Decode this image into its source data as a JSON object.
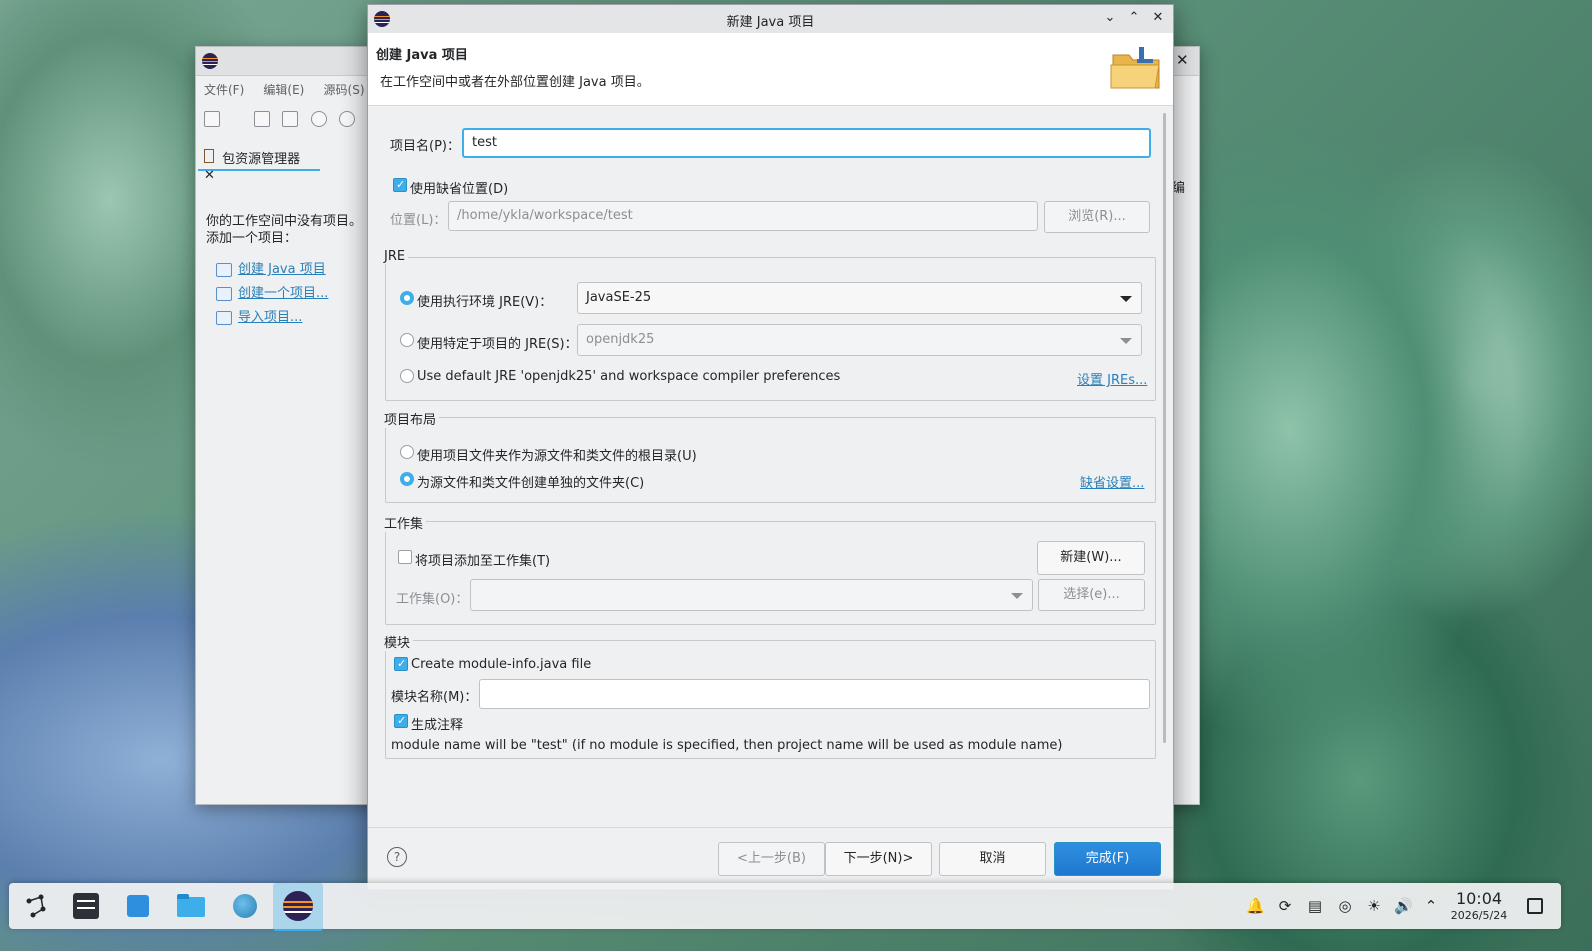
{
  "background_window": {
    "menu": [
      "文件(F)",
      "编辑(E)",
      "源码(S)"
    ],
    "package_tab_label": "包资源管理器",
    "empty_text_line1": "你的工作空间中没有项目。",
    "empty_text_line2": "添加一个项目：",
    "links": [
      "创建 Java 项目",
      "创建一个项目...",
      "导入项目..."
    ],
    "right_edge_text": "编"
  },
  "dialog": {
    "title": "新建 Java 项目",
    "header_title": "创建 Java 项目",
    "header_desc": "在工作空间中或者在外部位置创建 Java 项目。",
    "project_name_label": "项目名(P)：",
    "project_name_value": "test",
    "use_default_location_label": "使用缺省位置(D)",
    "use_default_location_checked": true,
    "location_label": "位置(L)：",
    "location_value": "/home/ykla/workspace/test",
    "browse_button": "浏览(R)...",
    "jre_group": "JRE",
    "jre_opt1_label": "使用执行环境 JRE(V)：",
    "jre_opt1_value": "JavaSE-25",
    "jre_opt2_label": "使用特定于项目的 JRE(S)：",
    "jre_opt2_value": "openjdk25",
    "jre_opt3_label": "Use default JRE 'openjdk25' and workspace compiler preferences",
    "jre_link": "设置 JREs...",
    "jre_selected": 1,
    "layout_group": "项目布局",
    "layout_opt1": "使用项目文件夹作为源文件和类文件的根目录(U)",
    "layout_opt2": "为源文件和类文件创建单独的文件夹(C)",
    "layout_link": "缺省设置...",
    "layout_selected": 2,
    "workingset_group": "工作集",
    "workingset_add_label": "将项目添加至工作集(T)",
    "workingset_new_button": "新建(W)...",
    "workingset_label": "工作集(O)：",
    "workingset_value": "",
    "workingset_select_button": "选择(e)...",
    "module_group": "模块",
    "module_create_label": "Create module-info.java file",
    "module_name_label": "模块名称(M)：",
    "module_name_value": "",
    "module_comments_label": "生成注释",
    "module_info_text": "module name will be \"test\" (if no module is specified, then project name will be used as module name)",
    "help_glyph": "?",
    "back_button": "<上一步(B)",
    "next_button": "下一步(N)>",
    "cancel_button": "取消",
    "finish_button": "完成(F)"
  },
  "taskbar": {
    "time": "10:04",
    "date": "2026/5/24",
    "apps": [
      "application-launcher-icon",
      "system-settings-icon",
      "discover-store-icon",
      "file-manager-icon",
      "web-browser-icon",
      "eclipse-icon"
    ],
    "tray": [
      "notification-icon",
      "update-icon",
      "clipboard-icon",
      "media-icon",
      "brightness-icon",
      "volume-icon",
      "expand-tray-icon",
      "show-desktop-icon"
    ]
  },
  "colors": {
    "accent": "#3daee9",
    "primary_button": "#1f78cf",
    "link": "#2980b9"
  }
}
